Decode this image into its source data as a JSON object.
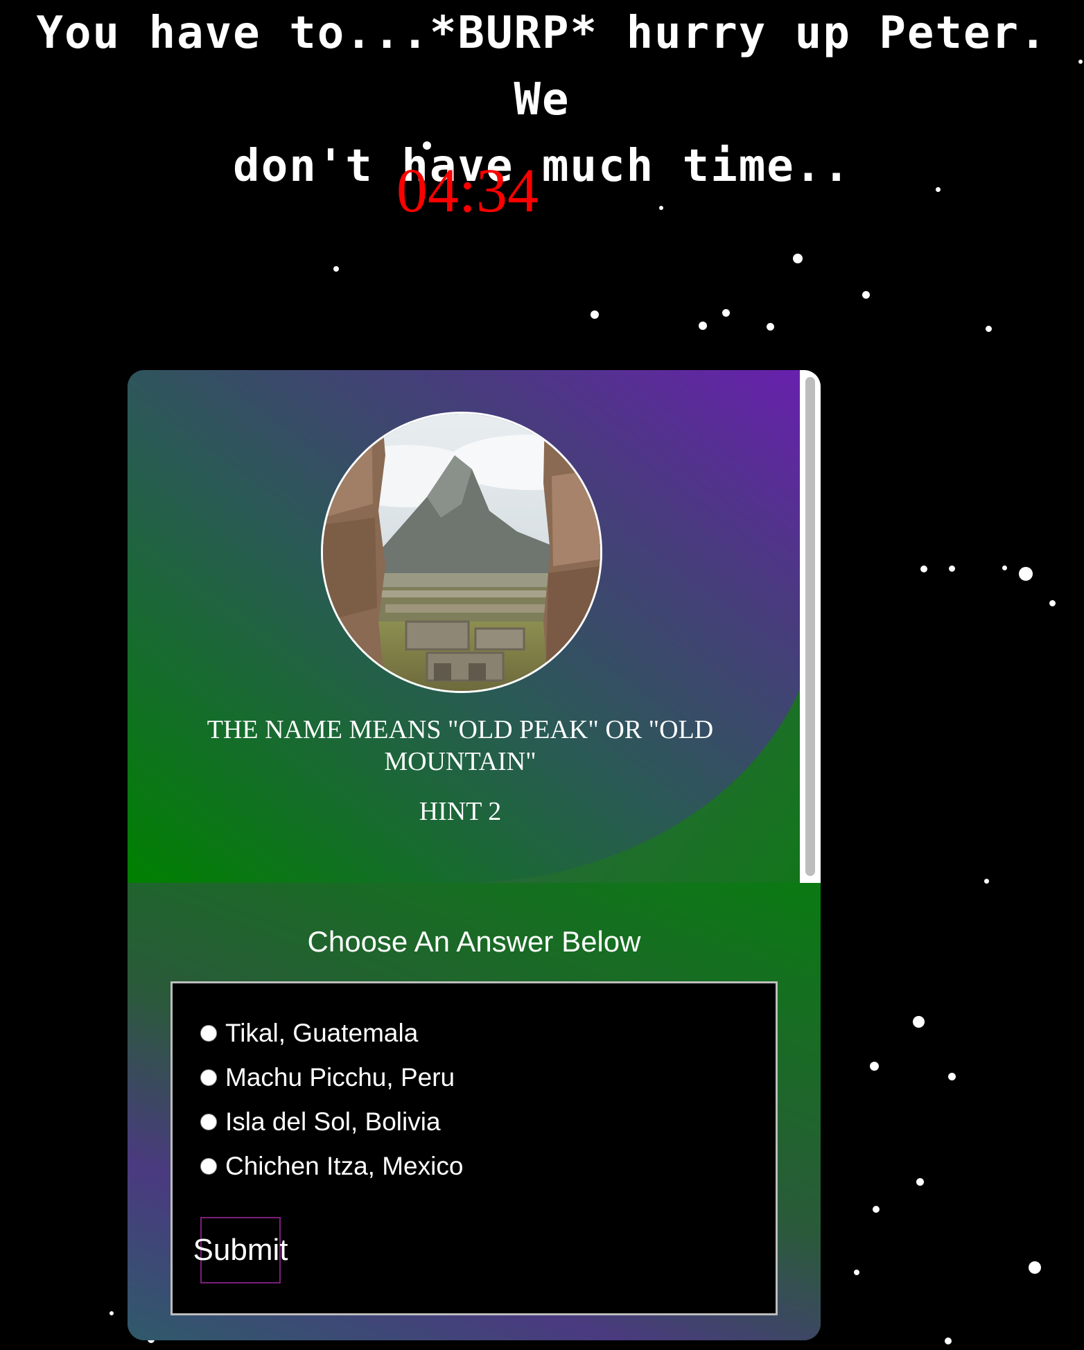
{
  "banner": {
    "line1": "You have to...*BURP* hurry up Peter. We",
    "line2": "don't have much time.."
  },
  "timer": "04:34",
  "card": {
    "hint_text": "THE NAME MEANS \"OLD PEAK\" OR \"OLD MOUNTAIN\"",
    "hint_label": "HINT 2",
    "choose_label": "Choose An Answer Below",
    "options": [
      "Tikal, Guatemala",
      "Machu Picchu, Peru",
      "Isla del Sol, Bolivia",
      "Chichen Itza, Mexico"
    ],
    "submit_label": "Submit"
  },
  "colors": {
    "timer": "#ff0000",
    "gradient_purple": "#6a1fb0",
    "gradient_green": "#008000",
    "submit_border": "#7a1f7a"
  }
}
